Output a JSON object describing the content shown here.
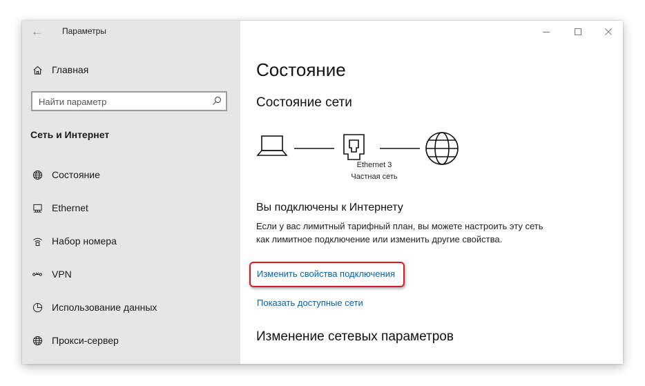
{
  "window": {
    "title": "Параметры",
    "controls": [
      "minimize-icon",
      "maximize-icon",
      "close-icon"
    ]
  },
  "sidebar": {
    "home_label": "Главная",
    "search": {
      "placeholder": "Найти параметр"
    },
    "section_title": "Сеть и Интернет",
    "items": [
      {
        "label": "Состояние",
        "icon": "globe-icon"
      },
      {
        "label": "Ethernet",
        "icon": "ethernet-icon"
      },
      {
        "label": "Набор номера",
        "icon": "dialup-icon"
      },
      {
        "label": "VPN",
        "icon": "vpn-icon"
      },
      {
        "label": "Использование данных",
        "icon": "data-usage-icon"
      },
      {
        "label": "Прокси-сервер",
        "icon": "globe-icon"
      }
    ]
  },
  "main": {
    "title": "Состояние",
    "network_status_title": "Состояние сети",
    "network": {
      "adapter": "Ethernet 3",
      "profile": "Частная сеть"
    },
    "connected_text": "Вы подключены к Интернету",
    "description": "Если у вас лимитный тарифный план, вы можете настроить эту сеть как лимитное подключение или изменить другие свойства.",
    "links": {
      "change_properties": "Изменить свойства подключения",
      "show_networks": "Показать доступные сети"
    },
    "change_settings_title": "Изменение сетевых параметров"
  },
  "colors": {
    "sidebar_bg": "#e6e6e6",
    "link": "#0063b1",
    "highlight": "#d71920"
  }
}
